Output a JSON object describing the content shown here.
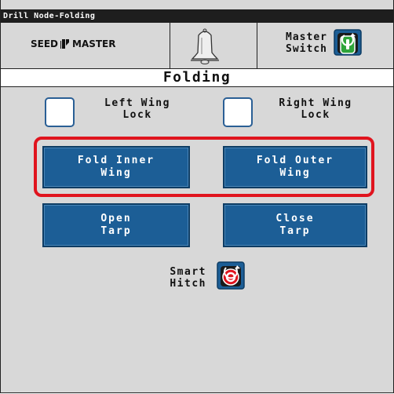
{
  "window": {
    "title": "Drill Node-Folding"
  },
  "header": {
    "logo_text": "SEED MASTER",
    "alarm_icon": "bell-icon",
    "master_switch_label": "Master\nSwitch",
    "master_switch_state": "on",
    "master_switch_color": "#2ea43a"
  },
  "page": {
    "title": "Folding"
  },
  "locks": {
    "left_label": "Left Wing\nLock",
    "right_label": "Right Wing\nLock",
    "left_checked": false,
    "right_checked": false
  },
  "buttons": {
    "fold_inner": "Fold Inner\nWing",
    "fold_outer": "Fold Outer\nWing",
    "open_tarp": "Open\nTarp",
    "close_tarp": "Close\nTarp"
  },
  "smart_hitch": {
    "label": "Smart\nHitch",
    "state": "off",
    "color": "#e0141e"
  },
  "colors": {
    "button_blue": "#1c5e96",
    "highlight_red": "#e0141e",
    "background": "#d8d8d8"
  }
}
